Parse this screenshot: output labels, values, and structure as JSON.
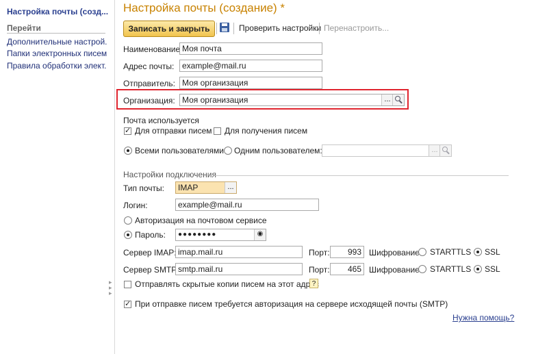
{
  "sidebar": {
    "title": "Настройка почты (созд...",
    "nav_header": "Перейти",
    "links": [
      "Дополнительные настрой...",
      "Папки электронных писем",
      "Правила обработки элект..."
    ]
  },
  "header": {
    "title": "Настройка почты (создание) *",
    "save_close": "Записать и закрыть",
    "check_settings": "Проверить настройки",
    "reconfigure": "Перенастроить..."
  },
  "form": {
    "name_label": "Наименование:",
    "name_value": "Моя почта",
    "address_label": "Адрес почты:",
    "address_value": "example@mail.ru",
    "sender_label": "Отправитель:",
    "sender_value": "Моя организация",
    "org_label": "Организация:",
    "org_value": "Моя организация",
    "usage_title": "Почта используется",
    "for_sending": "Для отправки писем",
    "for_receiving": "Для получения писем",
    "all_users": "Всеми пользователями",
    "one_user": "Одним пользователем:",
    "one_user_value": ""
  },
  "connection": {
    "group_title": "Настройки подключения",
    "mail_type_label": "Тип почты:",
    "mail_type_value": "IMAP",
    "login_label": "Логин:",
    "login_value": "example@mail.ru",
    "auth_service": "Авторизация на почтовом сервисе",
    "password_label": "Пароль:",
    "password_value": "●●●●●●●●",
    "imap_label": "Сервер IMAP:",
    "imap_value": "imap.mail.ru",
    "smtp_label": "Сервер SMTP:",
    "smtp_value": "smtp.mail.ru",
    "port_label": "Порт:",
    "imap_port": "993",
    "smtp_port": "465",
    "encryption_label": "Шифрование:",
    "starttls": "STARTTLS",
    "ssl": "SSL",
    "bcc_label": "Отправлять скрытые копии писем на этот адрес",
    "bcc_help": "?",
    "smtp_auth_label": "При отправке писем требуется авторизация на сервере исходящей почты (SMTP)"
  },
  "footer": {
    "help_link": "Нужна помощь?"
  },
  "icons": {
    "choose": "...",
    "search": "search-icon",
    "eye": "eye-icon",
    "save": "floppy-disk-icon"
  },
  "colors": {
    "title": "#c88200",
    "link": "#2a3f8f",
    "highlight": "#e0242e",
    "button": "#f1c44e"
  }
}
